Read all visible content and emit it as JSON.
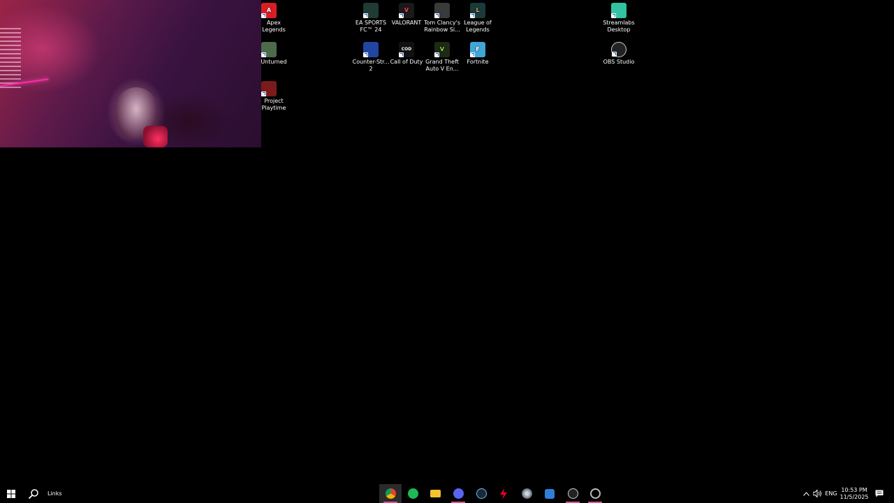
{
  "desktop": {
    "icons": [
      {
        "label": "Apex Legends",
        "line1": "Apex",
        "line2": "Legends",
        "icon": "apex-legends-icon",
        "color": "#d81e24",
        "glyph": "A"
      },
      {
        "label": "Unturned",
        "line1": "Unturned",
        "line2": "",
        "icon": "unturned-icon",
        "color": "#4d6b4a",
        "glyph": ""
      },
      {
        "label": "Project Playtime",
        "line1": "Project",
        "line2": "Playtime",
        "icon": "project-playtime-icon",
        "color": "#7a1b1b",
        "glyph": ""
      },
      {
        "label": "EA SPORTS FC™ 24",
        "line1": "EA SPORTS",
        "line2": "FC™ 24",
        "icon": "ea-sports-fc-icon",
        "color": "#1f3b34",
        "glyph": ""
      },
      {
        "label": "VALORANT",
        "line1": "VALORANT",
        "line2": "",
        "icon": "valorant-icon",
        "color": "#1a1a1a",
        "glyph": "V"
      },
      {
        "label": "Tom Clancy's Rainbow Si...",
        "line1": "Tom Clancy's",
        "line2": "Rainbow Si...",
        "icon": "rainbow-six-icon",
        "color": "#3a3a3a",
        "glyph": ""
      },
      {
        "label": "League of Legends",
        "line1": "League of",
        "line2": "Legends",
        "icon": "league-of-legends-icon",
        "color": "#1b3a3a",
        "glyph": "L"
      },
      {
        "label": "Counter-Str... 2",
        "line1": "Counter-Str...",
        "line2": "2",
        "icon": "counter-strike-icon",
        "color": "#2046a0",
        "glyph": ""
      },
      {
        "label": "Call of Duty",
        "line1": "Call of Duty",
        "line2": "",
        "icon": "call-of-duty-icon",
        "color": "#111111",
        "glyph": "COD"
      },
      {
        "label": "Grand Theft Auto V En...",
        "line1": "Grand Theft",
        "line2": "Auto V En...",
        "icon": "gta-v-icon",
        "color": "#1d2b14",
        "glyph": "V"
      },
      {
        "label": "Fortnite",
        "line1": "Fortnite",
        "line2": "",
        "icon": "fortnite-icon",
        "color": "#3fa6d8",
        "glyph": "F"
      },
      {
        "label": "Streamlabs Desktop",
        "line1": "Streamlabs",
        "line2": "Desktop",
        "icon": "streamlabs-icon",
        "color": "#31c3a2",
        "glyph": ""
      },
      {
        "label": "OBS Studio",
        "line1": "OBS Studio",
        "line2": "",
        "icon": "obs-studio-icon",
        "color": "#222222",
        "glyph": ""
      }
    ]
  },
  "taskbar": {
    "search_label": "Links",
    "apps": [
      {
        "name": "chrome-icon",
        "color": "#e9b52a",
        "active": true
      },
      {
        "name": "spotify-icon",
        "color": "#1db954",
        "active": false
      },
      {
        "name": "file-explorer-icon",
        "color": "#f2c230",
        "active": false
      },
      {
        "name": "discord-icon",
        "color": "#5865f2",
        "active": false
      },
      {
        "name": "steam-icon",
        "color": "#66c0f4",
        "active": false
      },
      {
        "name": "riot-client-icon",
        "color": "#eb0029",
        "active": false
      },
      {
        "name": "app-icon",
        "color": "#9aa3b0",
        "active": false
      },
      {
        "name": "app-icon",
        "color": "#2f7fd6",
        "active": false
      },
      {
        "name": "obs-studio-icon",
        "color": "#cfcfcf",
        "active": false
      },
      {
        "name": "ubisoft-connect-icon",
        "color": "#bbbbbb",
        "active": false
      }
    ],
    "tray": {
      "language": "ENG",
      "time": "10:53 PM",
      "date": "11/5/2025"
    }
  }
}
